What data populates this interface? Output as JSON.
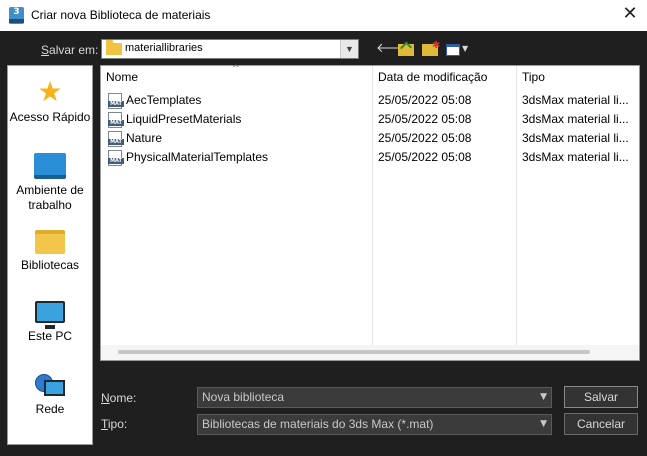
{
  "window": {
    "title": "Criar nova Biblioteca de materiais",
    "app_icon_text": "3",
    "close_glyph": "✕"
  },
  "toolbar": {
    "save_in_label": "Salvar em:",
    "save_in_accel": "S",
    "save_in_rest": "alvar em:",
    "path_value": "materiallibraries",
    "back_icon": "back-arrow-icon",
    "up_icon": "up-folder-icon",
    "new_folder_icon": "new-folder-icon",
    "view_icon": "view-menu-icon"
  },
  "places": [
    {
      "label": "Acesso Rápido",
      "icon": "star-icon"
    },
    {
      "label": "Ambiente de trabalho",
      "icon": "desktop-icon"
    },
    {
      "label": "Bibliotecas",
      "icon": "libraries-folder-icon"
    },
    {
      "label": "Este PC",
      "icon": "computer-icon"
    },
    {
      "label": "Rede",
      "icon": "network-icon"
    }
  ],
  "columns": {
    "name": "Nome",
    "date": "Data de modificação",
    "type": "Tipo"
  },
  "files": [
    {
      "name": "AecTemplates",
      "date": "25/05/2022 05:08",
      "type": "3dsMax material li..."
    },
    {
      "name": "LiquidPresetMaterials",
      "date": "25/05/2022 05:08",
      "type": "3dsMax material li..."
    },
    {
      "name": "Nature",
      "date": "25/05/2022 05:08",
      "type": "3dsMax material li..."
    },
    {
      "name": "PhysicalMaterialTemplates",
      "date": "25/05/2022 05:08",
      "type": "3dsMax material li..."
    }
  ],
  "file_icon_text": "MAT",
  "form": {
    "name_label_accel": "N",
    "name_label_rest": "ome:",
    "name_value": "Nova biblioteca",
    "type_label_accel": "T",
    "type_label_rest": "ipo:",
    "type_value": "Bibliotecas de materiais do 3ds Max (*.mat)"
  },
  "buttons": {
    "save": "Salvar",
    "cancel": "Cancelar"
  },
  "colors": {
    "dialog_bg": "#1f1f1f",
    "accent_blue": "#2a8ed6",
    "folder_yellow": "#f0c443"
  }
}
